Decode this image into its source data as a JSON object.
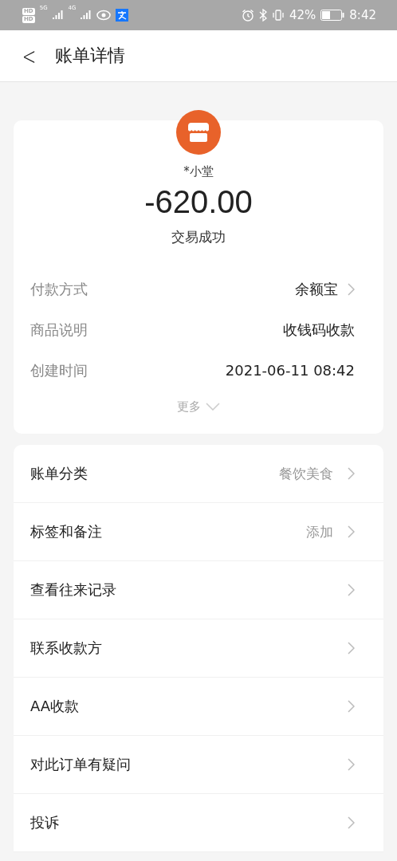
{
  "status_bar": {
    "hd_badges": [
      "HD",
      "HD"
    ],
    "networks": [
      "5G",
      "4G"
    ],
    "battery_percent": "42%",
    "time": "8:42"
  },
  "header": {
    "back": "<",
    "title": "账单详情"
  },
  "summary": {
    "payee": "*小堂",
    "amount": "-620.00",
    "status": "交易成功",
    "details": [
      {
        "label": "付款方式",
        "value": "余额宝",
        "has_arrow": true
      },
      {
        "label": "商品说明",
        "value": "收钱码收款",
        "has_arrow": false
      },
      {
        "label": "创建时间",
        "value": "2021-06-11 08:42",
        "has_arrow": false
      }
    ],
    "more": "更多"
  },
  "actions": [
    {
      "label": "账单分类",
      "value": "餐饮美食"
    },
    {
      "label": "标签和备注",
      "value": "添加"
    },
    {
      "label": "查看往来记录"
    },
    {
      "label": "联系收款方"
    },
    {
      "label": "AA收款"
    },
    {
      "label": "对此订单有疑问"
    },
    {
      "label": "投诉"
    }
  ]
}
